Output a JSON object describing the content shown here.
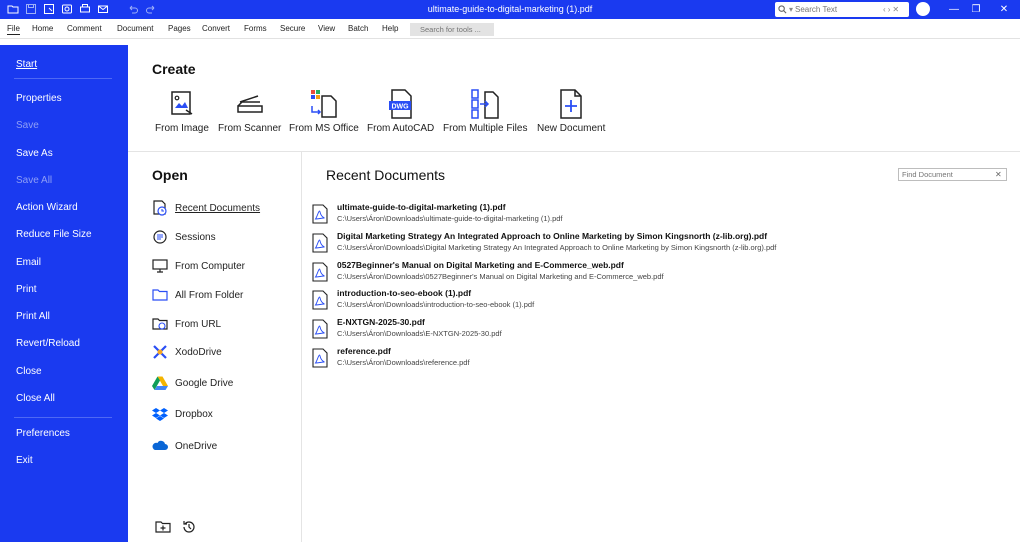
{
  "window": {
    "title": "ultimate-guide-to-digital-marketing (1).pdf",
    "search_placeholder": "Search Text"
  },
  "menu": {
    "items": [
      "File",
      "Home",
      "Comment",
      "Document",
      "Pages",
      "Convert",
      "Forms",
      "Secure",
      "View",
      "Batch",
      "Help"
    ],
    "tool_search_placeholder": "Search for tools ..."
  },
  "sidebar": {
    "items": [
      {
        "label": "Start",
        "state": "selected"
      },
      {
        "label": "Properties",
        "state": "enabled"
      },
      {
        "label": "Save",
        "state": "disabled"
      },
      {
        "label": "Save As",
        "state": "enabled"
      },
      {
        "label": "Save All",
        "state": "disabled"
      },
      {
        "label": "Action Wizard",
        "state": "enabled"
      },
      {
        "label": "Reduce File Size",
        "state": "enabled"
      },
      {
        "label": "Email",
        "state": "enabled"
      },
      {
        "label": "Print",
        "state": "enabled"
      },
      {
        "label": "Print All",
        "state": "enabled"
      },
      {
        "label": "Revert/Reload",
        "state": "enabled"
      },
      {
        "label": "Close",
        "state": "enabled"
      },
      {
        "label": "Close All",
        "state": "enabled"
      },
      {
        "label": "Preferences",
        "state": "enabled"
      },
      {
        "label": "Exit",
        "state": "enabled"
      }
    ]
  },
  "create": {
    "title": "Create",
    "items": [
      {
        "label": "From Image",
        "icon": "image-icon"
      },
      {
        "label": "From Scanner",
        "icon": "scanner-icon"
      },
      {
        "label": "From MS Office",
        "icon": "ms-office-icon"
      },
      {
        "label": "From AutoCAD",
        "icon": "autocad-icon",
        "badge": "DWG"
      },
      {
        "label": "From Multiple Files",
        "icon": "multiple-files-icon"
      },
      {
        "label": "New Document",
        "icon": "new-document-icon"
      }
    ]
  },
  "open": {
    "title": "Open",
    "items": [
      {
        "label": "Recent Documents",
        "icon": "recent-documents-icon",
        "selected": true
      },
      {
        "label": "Sessions",
        "icon": "sessions-icon"
      },
      {
        "label": "From Computer",
        "icon": "computer-icon"
      },
      {
        "label": "All From Folder",
        "icon": "folder-icon"
      },
      {
        "label": "From URL",
        "icon": "url-icon"
      },
      {
        "label": "XodoDrive",
        "icon": "xodo-drive-icon"
      },
      {
        "label": "Google Drive",
        "icon": "google-drive-icon"
      },
      {
        "label": "Dropbox",
        "icon": "dropbox-icon"
      },
      {
        "label": "OneDrive",
        "icon": "onedrive-icon"
      }
    ]
  },
  "recent": {
    "title": "Recent Documents",
    "find_placeholder": "Find Document",
    "documents": [
      {
        "name": "ultimate-guide-to-digital-marketing (1).pdf",
        "path": "C:\\Users\\Áron\\Downloads\\ultimate-guide-to-digital-marketing (1).pdf"
      },
      {
        "name": "Digital Marketing Strategy An Integrated Approach to Online Marketing by Simon Kingsnorth (z-lib.org).pdf",
        "path": "C:\\Users\\Áron\\Downloads\\Digital Marketing Strategy An Integrated Approach to Online Marketing by Simon Kingsnorth (z-lib.org).pdf"
      },
      {
        "name": "0527Beginner's Manual on Digital Marketing and E-Commerce_web.pdf",
        "path": "C:\\Users\\Áron\\Downloads\\0527Beginner's Manual on Digital Marketing and E-Commerce_web.pdf"
      },
      {
        "name": "introduction-to-seo-ebook (1).pdf",
        "path": "C:\\Users\\Áron\\Downloads\\introduction-to-seo-ebook (1).pdf"
      },
      {
        "name": "E-NXTGN-2025-30.pdf",
        "path": "C:\\Users\\Áron\\Downloads\\E-NXTGN-2025-30.pdf"
      },
      {
        "name": "reference.pdf",
        "path": "C:\\Users\\Áron\\Downloads\\reference.pdf"
      }
    ]
  },
  "colors": {
    "accent": "#1a3af0",
    "sidebar_disabled_text": "#8f9ff6"
  }
}
